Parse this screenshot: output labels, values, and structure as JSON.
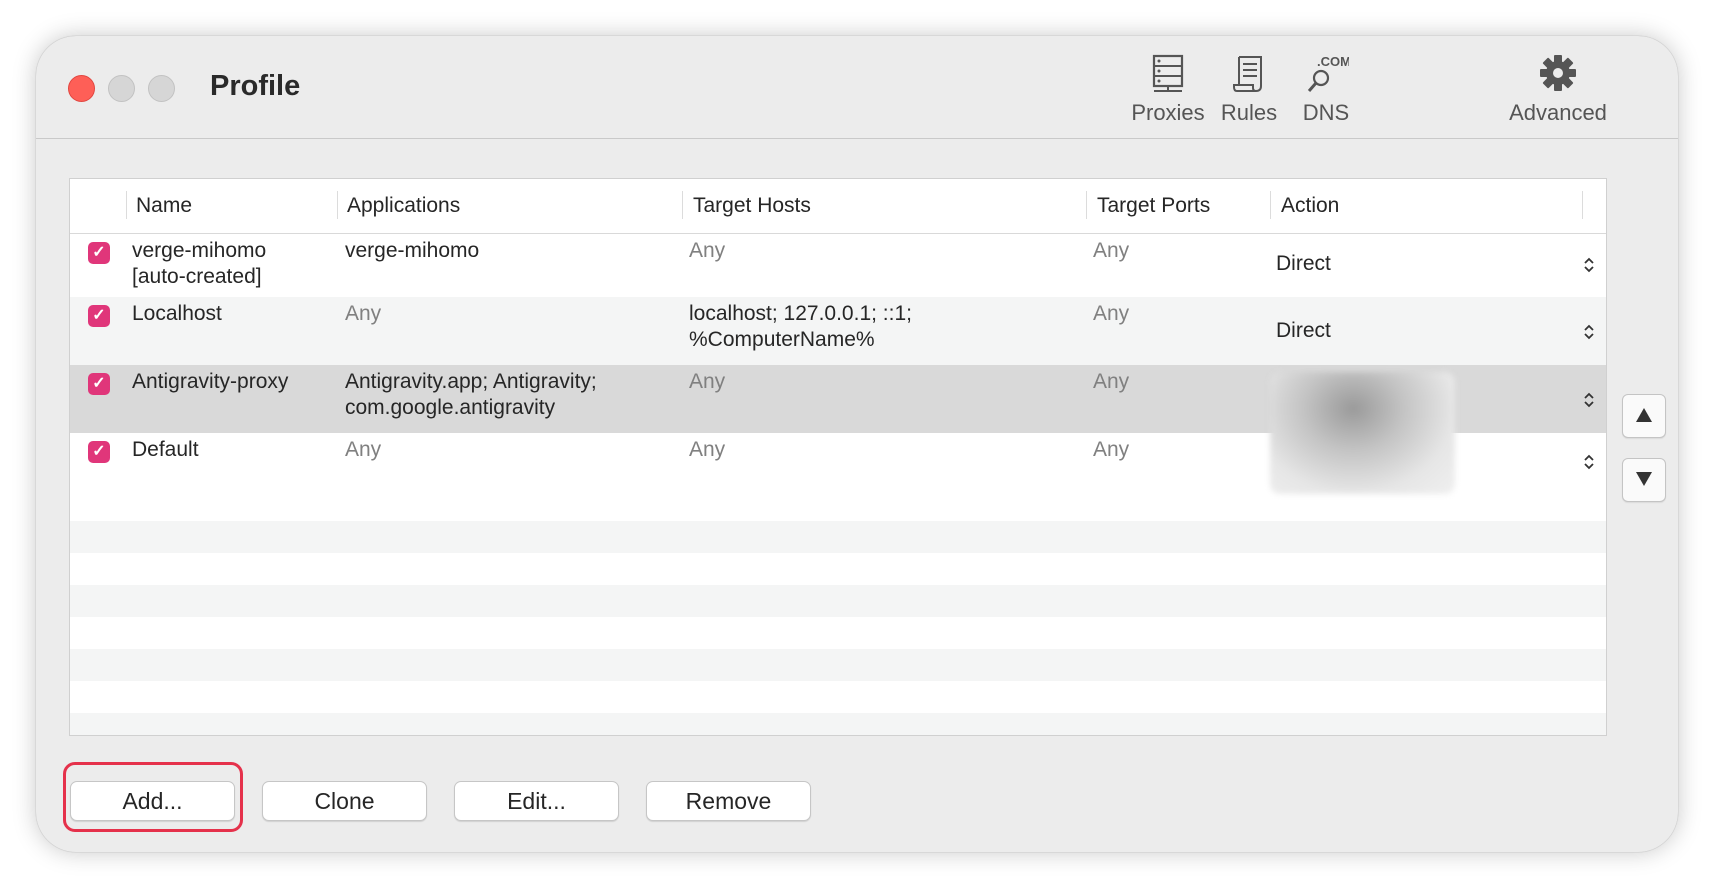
{
  "window": {
    "title": "Profile",
    "toolbar": [
      {
        "label": "Proxies",
        "icon": "server-icon"
      },
      {
        "label": "Rules",
        "icon": "scroll-icon"
      },
      {
        "label": "DNS",
        "icon": "dns-search-icon",
        "icon_text": ".COM"
      },
      {
        "label": "Advanced",
        "icon": "gear-icon"
      }
    ]
  },
  "table": {
    "columns": [
      "Name",
      "Applications",
      "Target Hosts",
      "Target Ports",
      "Action"
    ],
    "rows": [
      {
        "checked": true,
        "name": "verge-mihomo\n[auto-created]",
        "applications": "verge-mihomo",
        "hosts": "Any",
        "ports": "Any",
        "action": "Direct"
      },
      {
        "checked": true,
        "name": "Localhost",
        "applications": "Any",
        "hosts": "localhost; 127.0.0.1; ::1;\n%ComputerName%",
        "ports": "Any",
        "action": "Direct"
      },
      {
        "checked": true,
        "name": "Antigravity-proxy",
        "applications": "Antigravity.app; Antigravity;\ncom.google.antigravity",
        "hosts": "Any",
        "ports": "Any",
        "action": ""
      },
      {
        "checked": true,
        "name": "Default",
        "applications": "Any",
        "hosts": "Any",
        "ports": "Any",
        "action": ""
      }
    ]
  },
  "buttons": {
    "add": "Add...",
    "clone": "Clone",
    "edit": "Edit...",
    "remove": "Remove"
  },
  "colors": {
    "checkbox": "#e0367a",
    "highlight": "#e5314b",
    "close": "#fe5f57"
  }
}
